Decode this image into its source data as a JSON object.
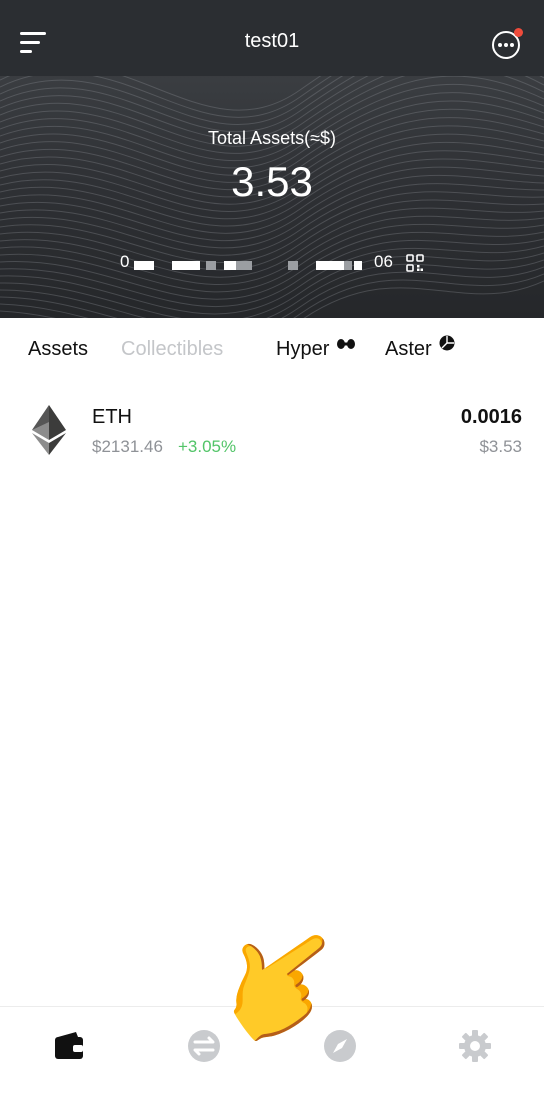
{
  "header": {
    "wallet_name": "test01",
    "total_label": "Total Assets(≈$)",
    "total_value": "3.53",
    "address_start": "0",
    "address_end": "06"
  },
  "tabs": [
    {
      "label": "Assets",
      "active": true
    },
    {
      "label": "Collectibles",
      "active": false
    },
    {
      "label": "Hyper",
      "active": false
    },
    {
      "label": "Aster",
      "active": false
    }
  ],
  "assets": [
    {
      "symbol": "ETH",
      "price": "$2131.46",
      "change": "+3.05%",
      "balance": "0.0016",
      "value": "$3.53"
    }
  ],
  "bottom_nav": [
    {
      "icon": "wallet-icon",
      "active": true
    },
    {
      "icon": "swap-icon",
      "active": false
    },
    {
      "icon": "compass-icon",
      "active": false
    },
    {
      "icon": "gear-icon",
      "active": false
    }
  ],
  "colors": {
    "accent_green": "#52c468",
    "notification_red": "#ef4b3b",
    "header_bg": "#2b2e32"
  }
}
